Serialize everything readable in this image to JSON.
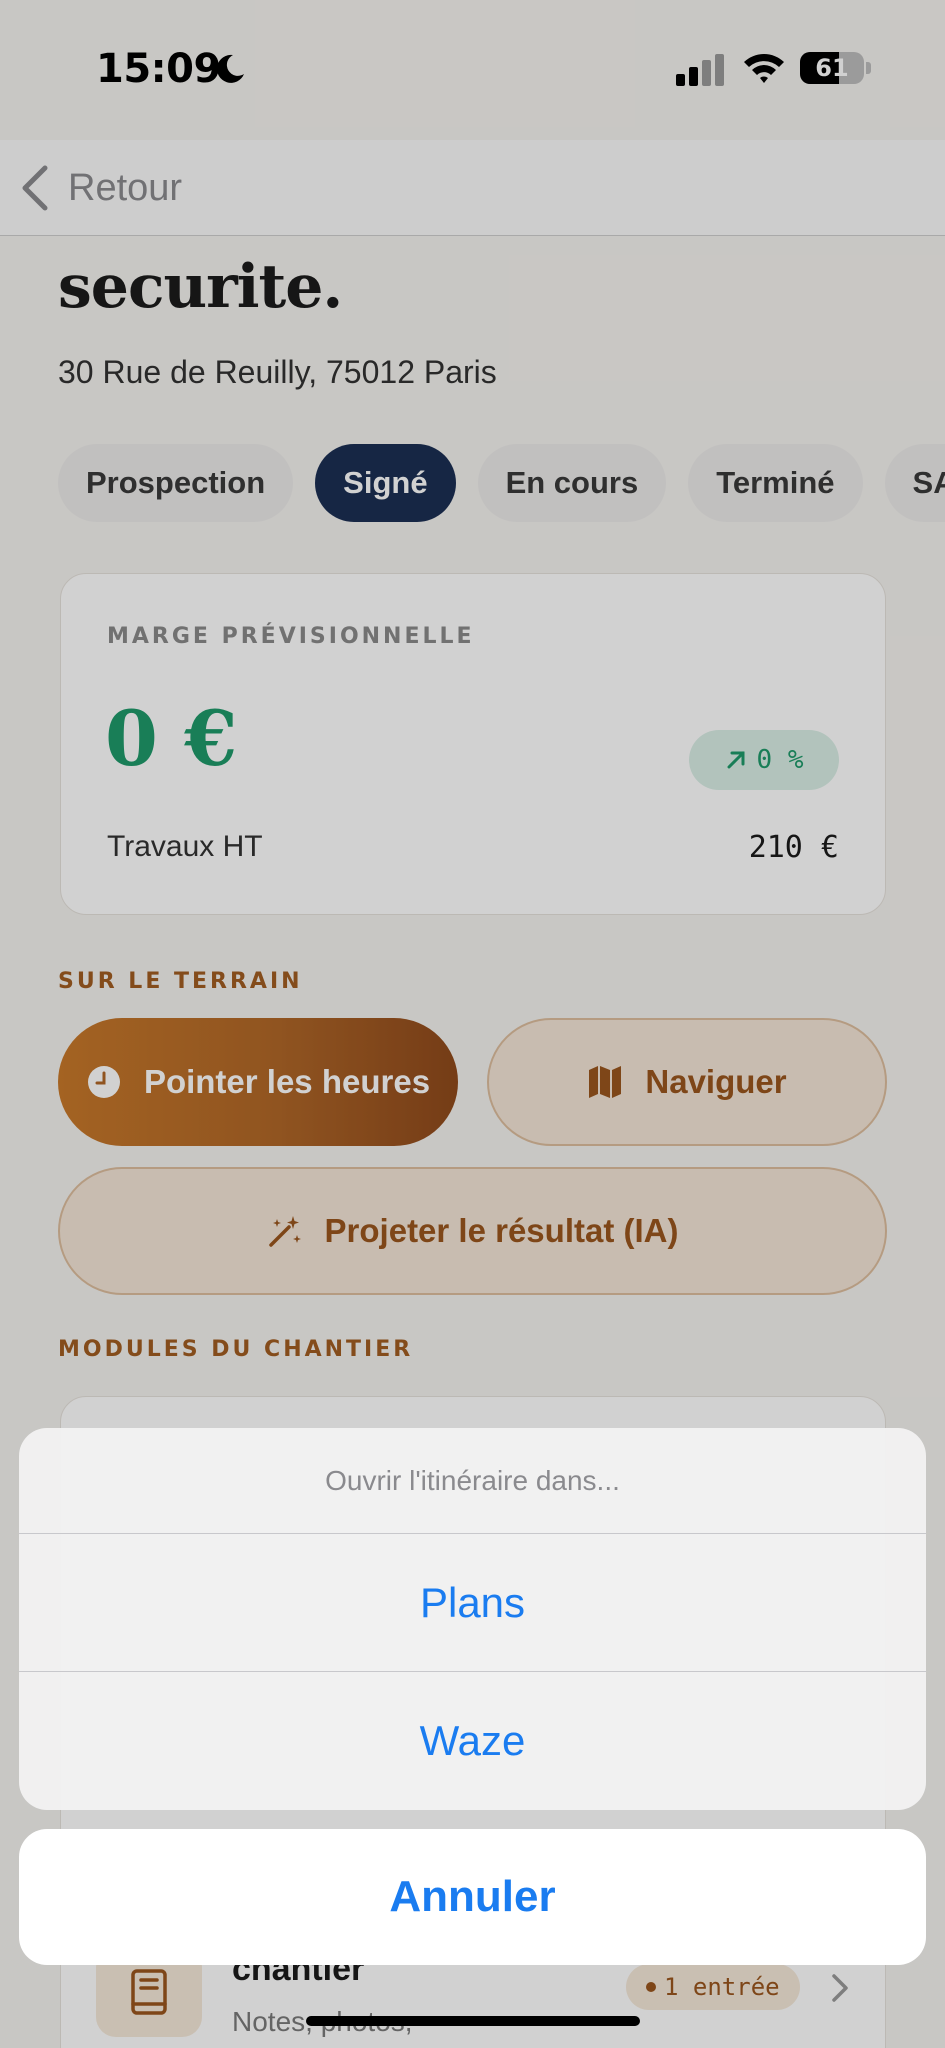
{
  "status_bar": {
    "time": "15:09",
    "battery": "61",
    "battery_level": 0.61
  },
  "nav": {
    "back_label": "Retour"
  },
  "project": {
    "title": "securite.",
    "address": "30 Rue de Reuilly, 75012 Paris"
  },
  "status_chips": [
    {
      "label": "Prospection",
      "active": false
    },
    {
      "label": "Signé",
      "active": true
    },
    {
      "label": "En cours",
      "active": false
    },
    {
      "label": "Terminé",
      "active": false
    },
    {
      "label": "SAV",
      "active": false
    }
  ],
  "margin_card": {
    "label": "MARGE PRÉVISIONNELLE",
    "value": "0 €",
    "percent": "0 %",
    "works_label": "Travaux HT",
    "works_value": "210 €"
  },
  "field": {
    "section_label": "SUR LE TERRAIN",
    "clock_in_label": "Pointer les heures",
    "navigate_label": "Naviguer",
    "project_ai_label": "Projeter le résultat (IA)"
  },
  "modules": {
    "section_label": "MODULES DU CHANTIER",
    "journal_title": "chantier",
    "journal_subtitle": "Notes, photos, …",
    "journal_badge": "1 entrée"
  },
  "action_sheet": {
    "title": "Ouvrir l'itinéraire dans...",
    "options": [
      "Plans",
      "Waze"
    ],
    "cancel_label": "Annuler"
  },
  "colors": {
    "accent_orange": "#b06728",
    "navy": "#1c2f54",
    "success_green": "#1f9a6b",
    "ios_blue": "#1a7cf0"
  }
}
